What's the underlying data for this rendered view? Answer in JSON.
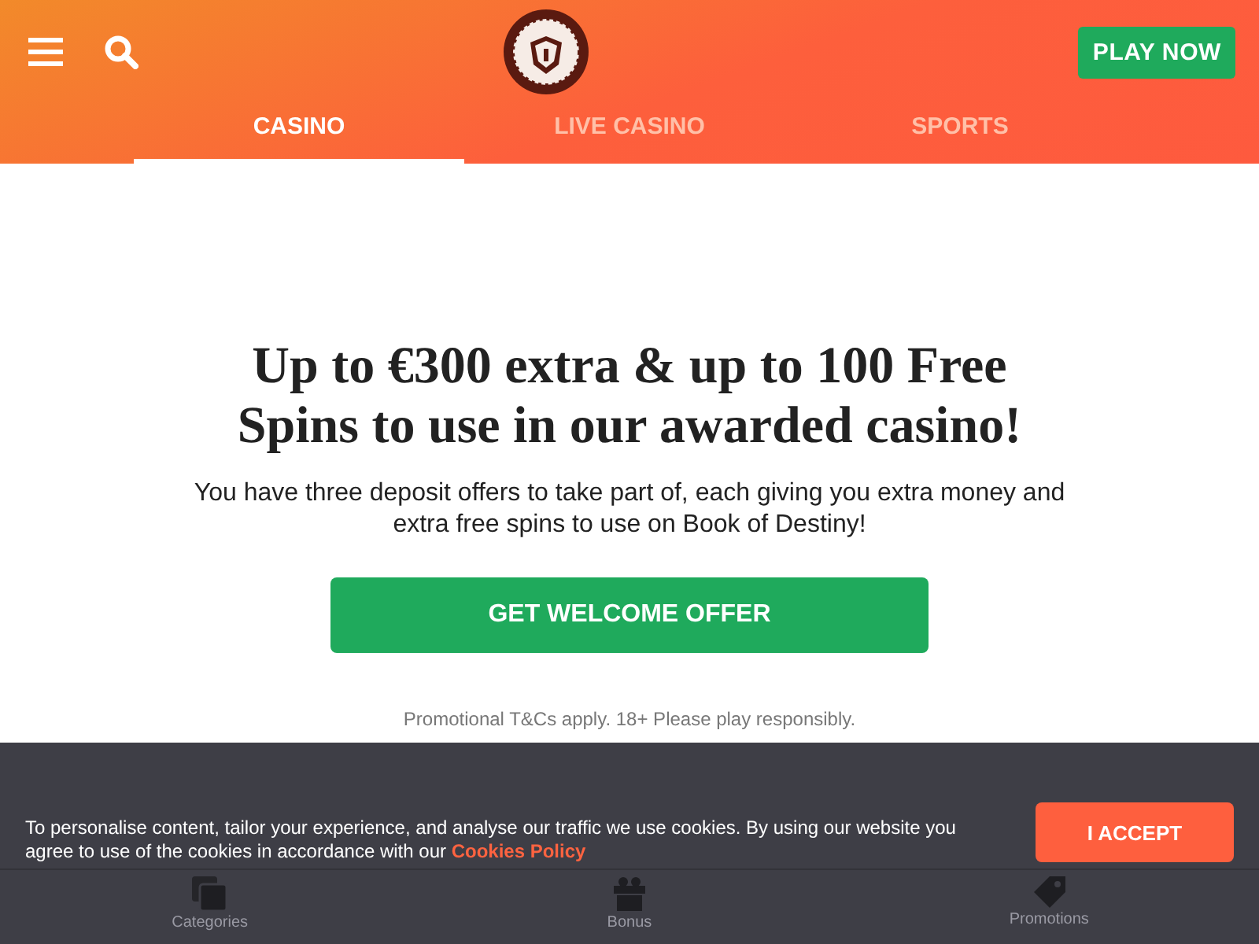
{
  "header": {
    "play_button": "PLAY NOW"
  },
  "tabs": [
    {
      "label": "CASINO",
      "selected": true
    },
    {
      "label": "LIVE CASINO",
      "selected": false
    },
    {
      "label": "SPORTS",
      "selected": false
    }
  ],
  "hero": {
    "title": "Up to €300 extra & up to 100 Free Spins to use in our awarded casino!",
    "text": "You have three deposit offers to take part of, each giving you extra money and extra free spins to use on Book of Destiny!",
    "button": "GET WELCOME OFFER",
    "terms": "Promotional T&Cs apply. 18+ Please play responsibly."
  },
  "cookie_banner": {
    "text": "To personalise content, tailor your experience, and analyse our traffic we use cookies. By using our website you agree to use of the cookies in accordance with our",
    "link": "Cookies Policy",
    "button": "I ACCEPT"
  },
  "bottom_nav": [
    {
      "kind": "categories",
      "label": "Categories"
    },
    {
      "kind": "bonus",
      "label": "Bonus"
    },
    {
      "kind": "promotions",
      "label": "Promotions"
    }
  ]
}
